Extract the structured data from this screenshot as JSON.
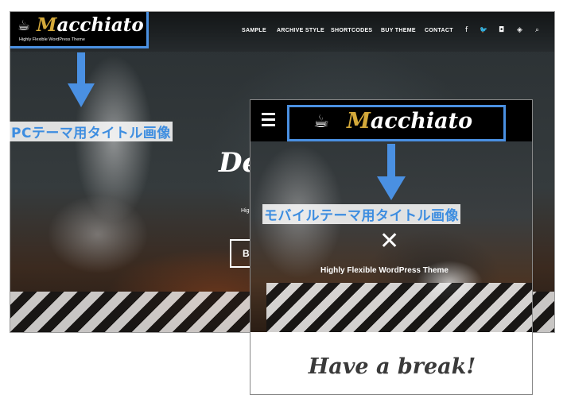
{
  "pc": {
    "logo": {
      "initial": "M",
      "name_rest": "acchiato",
      "tagline": "Highly Flexible WordPress Theme",
      "icon": "coffee-cup-icon"
    },
    "nav": [
      {
        "label": "SAMPLE"
      },
      {
        "label": "ARCHIVE STYLE"
      },
      {
        "label": "SHORTCODES"
      },
      {
        "label": "BUY THEME"
      },
      {
        "label": "CONTACT"
      }
    ],
    "social_icons": [
      {
        "name": "facebook-icon",
        "glyph": "f"
      },
      {
        "name": "twitter-icon",
        "glyph": "🐦"
      },
      {
        "name": "instagram-icon",
        "glyph": "◘"
      },
      {
        "name": "feedly-icon",
        "glyph": "◈"
      },
      {
        "name": "search-icon",
        "glyph": "⌕"
      }
    ],
    "hero": {
      "headline": "Deli",
      "subtitle": "Highly",
      "button_label": "BU"
    },
    "callout": "PCテーマ用タイトル画像"
  },
  "mobile": {
    "logo": {
      "initial": "M",
      "name_rest": "acchiato",
      "icon": "coffee-cup-icon"
    },
    "callout": "モバイルテーマ用タイトル画像",
    "close_glyph": "✕",
    "tagline": "Highly Flexible WordPress Theme",
    "section_heading": "Have a break!"
  },
  "colors": {
    "callout_blue": "#4a90e2",
    "logo_gold": "#d4a93a"
  }
}
